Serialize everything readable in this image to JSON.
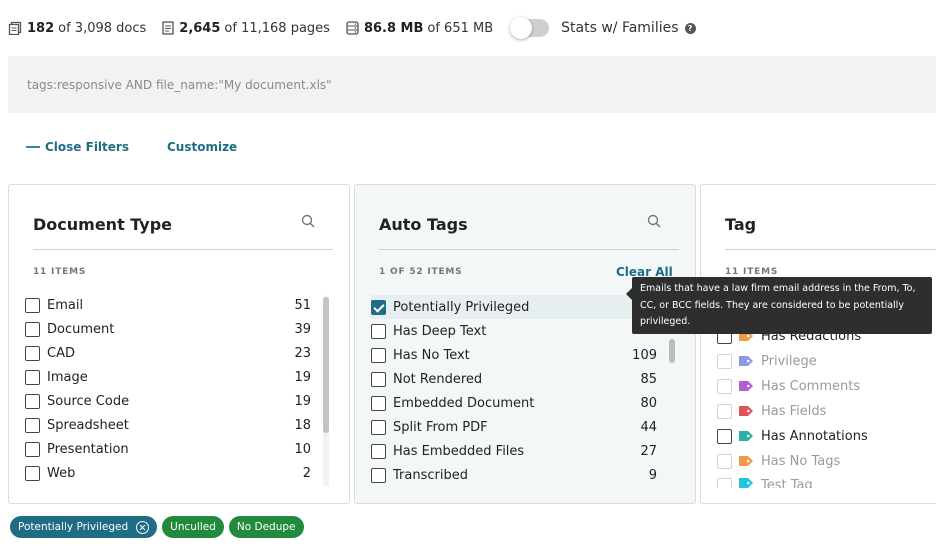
{
  "stats": {
    "docs": {
      "bold": "182",
      "rest": "of 3,098 docs"
    },
    "pages": {
      "bold": "2,645",
      "rest": "of 11,168 pages"
    },
    "size": {
      "bold": "86.8 MB",
      "rest": "of 651 MB"
    },
    "families_label": "Stats w/ Families",
    "families_on": false,
    "help_glyph": "?"
  },
  "query": {
    "value": "tags:responsive AND file_name:\"My document.xls\""
  },
  "filter_links": {
    "close": "Close Filters",
    "customize": "Customize"
  },
  "panels": {
    "document_type": {
      "title": "Document Type",
      "count": "11 ITEMS",
      "items": [
        {
          "label": "Email",
          "count": "51"
        },
        {
          "label": "Document",
          "count": "39"
        },
        {
          "label": "CAD",
          "count": "23"
        },
        {
          "label": "Image",
          "count": "19"
        },
        {
          "label": "Source Code",
          "count": "19"
        },
        {
          "label": "Spreadsheet",
          "count": "18"
        },
        {
          "label": "Presentation",
          "count": "10"
        },
        {
          "label": "Web",
          "count": "2"
        }
      ]
    },
    "auto_tags": {
      "title": "Auto Tags",
      "count": "1 OF 52 ITEMS",
      "clear": "Clear All",
      "items": [
        {
          "label": "Potentially Privileged",
          "count": "",
          "checked": true
        },
        {
          "label": "Has Deep Text",
          "count": ""
        },
        {
          "label": "Has No Text",
          "count": "109"
        },
        {
          "label": "Not Rendered",
          "count": "85"
        },
        {
          "label": "Embedded Document",
          "count": "80"
        },
        {
          "label": "Split From PDF",
          "count": "44"
        },
        {
          "label": "Has Embedded Files",
          "count": "27"
        },
        {
          "label": "Transcribed",
          "count": "9"
        }
      ]
    },
    "tag": {
      "title": "Tag",
      "count": "11 ITEMS",
      "items": [
        {
          "label": "Has Redactions",
          "color": "#f09a46",
          "enabled": true
        },
        {
          "label": "Privilege",
          "color": "#8c9ae6",
          "enabled": false
        },
        {
          "label": "Has Comments",
          "color": "#b05ed2",
          "enabled": false
        },
        {
          "label": "Has Fields",
          "color": "#e0525a",
          "enabled": false
        },
        {
          "label": "Has Annotations",
          "color": "#2ab0a8",
          "enabled": true
        },
        {
          "label": "Has No Tags",
          "color": "#f09a46",
          "enabled": false
        },
        {
          "label": "Test Tag",
          "color": "#22c4e0",
          "enabled": false
        }
      ]
    }
  },
  "tooltip": {
    "text": "Emails that have a law firm email address in the From, To, CC, or BCC fields. They are considered to be potentially privileged."
  },
  "pills": [
    {
      "label": "Potentially Privileged",
      "removable": true,
      "color": "#1f6d85"
    },
    {
      "label": "Unculled",
      "removable": false,
      "color": "#228a3c"
    },
    {
      "label": "No Dedupe",
      "removable": false,
      "color": "#228a3c"
    }
  ]
}
